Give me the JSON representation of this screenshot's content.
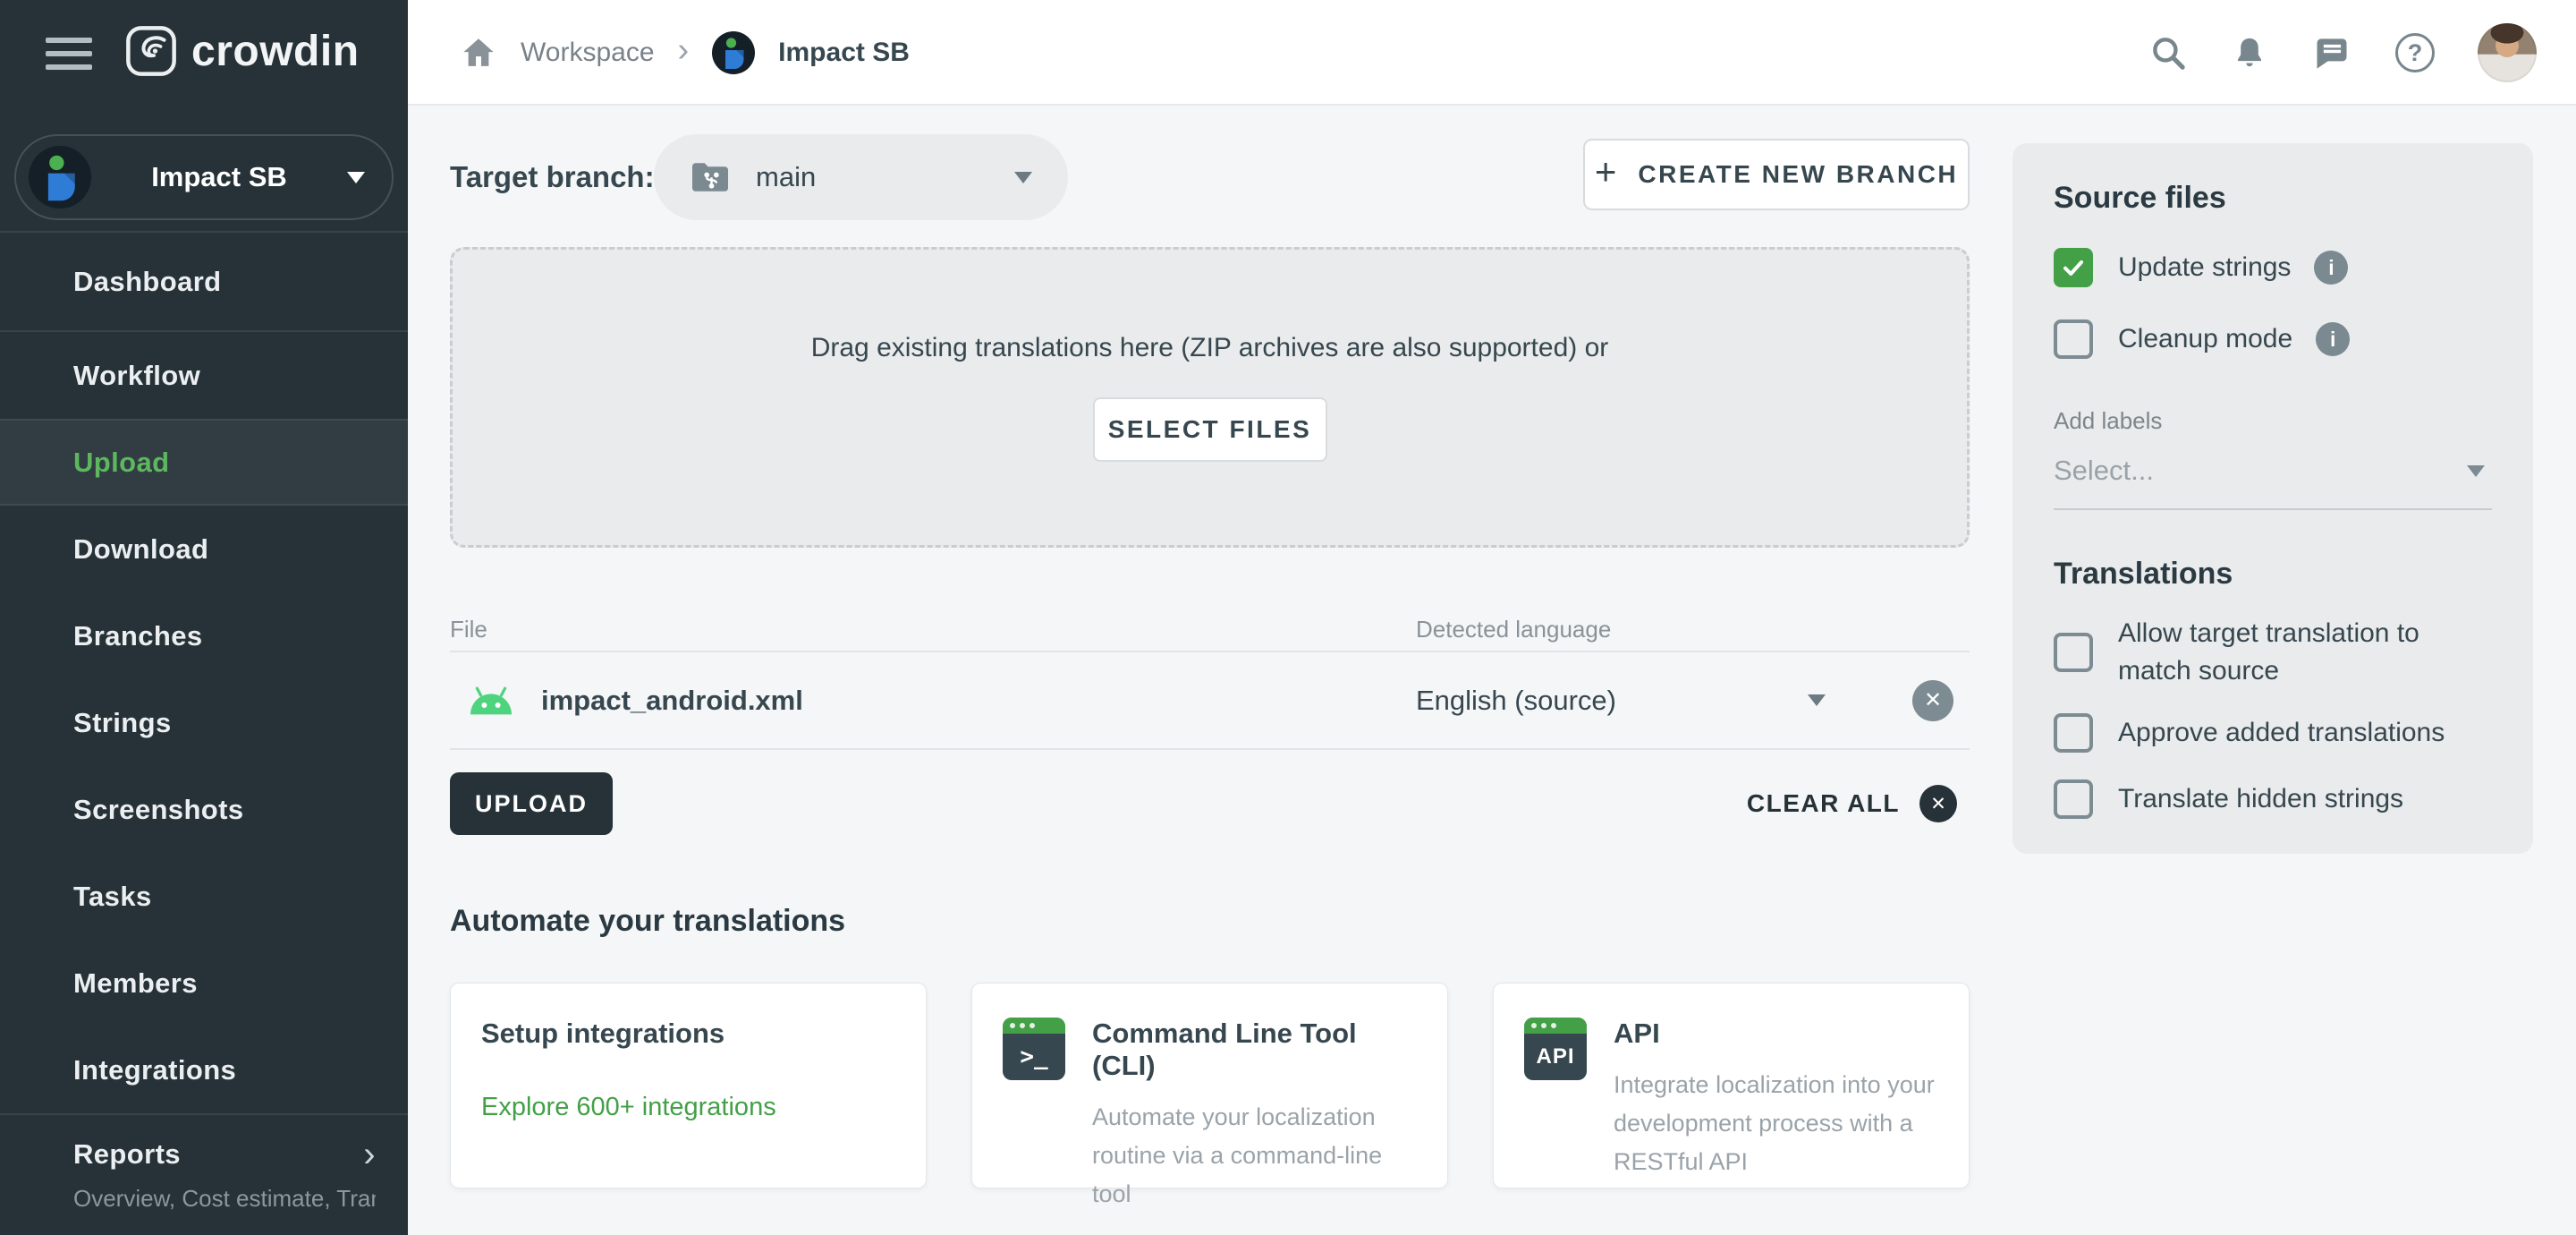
{
  "colors": {
    "accent_green": "#43a047",
    "sidebar_dark": "#263238",
    "active_item_green": "#5cb75f",
    "android_green": "#4ed37f"
  },
  "brand": {
    "logo_text": "crowdin"
  },
  "topbar": {
    "breadcrumb": {
      "workspace": "Workspace",
      "project": "Impact SB"
    }
  },
  "sidebar": {
    "project_name": "Impact SB",
    "items": [
      {
        "label": "Dashboard"
      },
      {
        "label": "Workflow"
      },
      {
        "label": "Upload",
        "active": true
      },
      {
        "label": "Download"
      },
      {
        "label": "Branches"
      },
      {
        "label": "Strings"
      },
      {
        "label": "Screenshots"
      },
      {
        "label": "Tasks"
      },
      {
        "label": "Members"
      },
      {
        "label": "Integrations"
      },
      {
        "label": "Reports"
      }
    ],
    "reports_subtitle": "Overview, Cost estimate, Transl…"
  },
  "main": {
    "target_branch_label": "Target branch:",
    "branch_name": "main",
    "create_branch_label": "CREATE NEW BRANCH",
    "dropzone_text": "Drag existing translations here (ZIP archives are also supported) or",
    "select_files_label": "SELECT FILES",
    "table": {
      "col_file": "File",
      "col_language": "Detected language",
      "file_name": "impact_android.xml",
      "detected_language": "English (source)"
    },
    "upload_label": "UPLOAD",
    "clear_all_label": "CLEAR ALL",
    "automate_heading": "Automate your translations",
    "cards": [
      {
        "title": "Setup integrations",
        "link": "Explore 600+ integrations"
      },
      {
        "title": "Command Line Tool (CLI)",
        "body": "Automate your localization routine via a command-line tool"
      },
      {
        "title": "API",
        "body": "Integrate localization into your development process with a RESTful API"
      }
    ]
  },
  "panel": {
    "source_files_heading": "Source files",
    "update_strings_label": "Update strings",
    "update_strings_checked": true,
    "cleanup_mode_label": "Cleanup mode",
    "cleanup_mode_checked": false,
    "add_labels_label": "Add labels",
    "select_placeholder": "Select...",
    "translations_heading": "Translations",
    "allow_match_label": "Allow target translation to match source",
    "allow_match_checked": false,
    "approve_added_label": "Approve added translations",
    "approve_added_checked": false,
    "translate_hidden_label": "Translate hidden strings",
    "translate_hidden_checked": false
  },
  "icons": {
    "plus_glyph": "+",
    "chevron_right_glyph": "›",
    "question_glyph": "?",
    "info_glyph": "i",
    "close_glyph": "✕",
    "terminal_glyph": ">_",
    "api_glyph": "API"
  }
}
